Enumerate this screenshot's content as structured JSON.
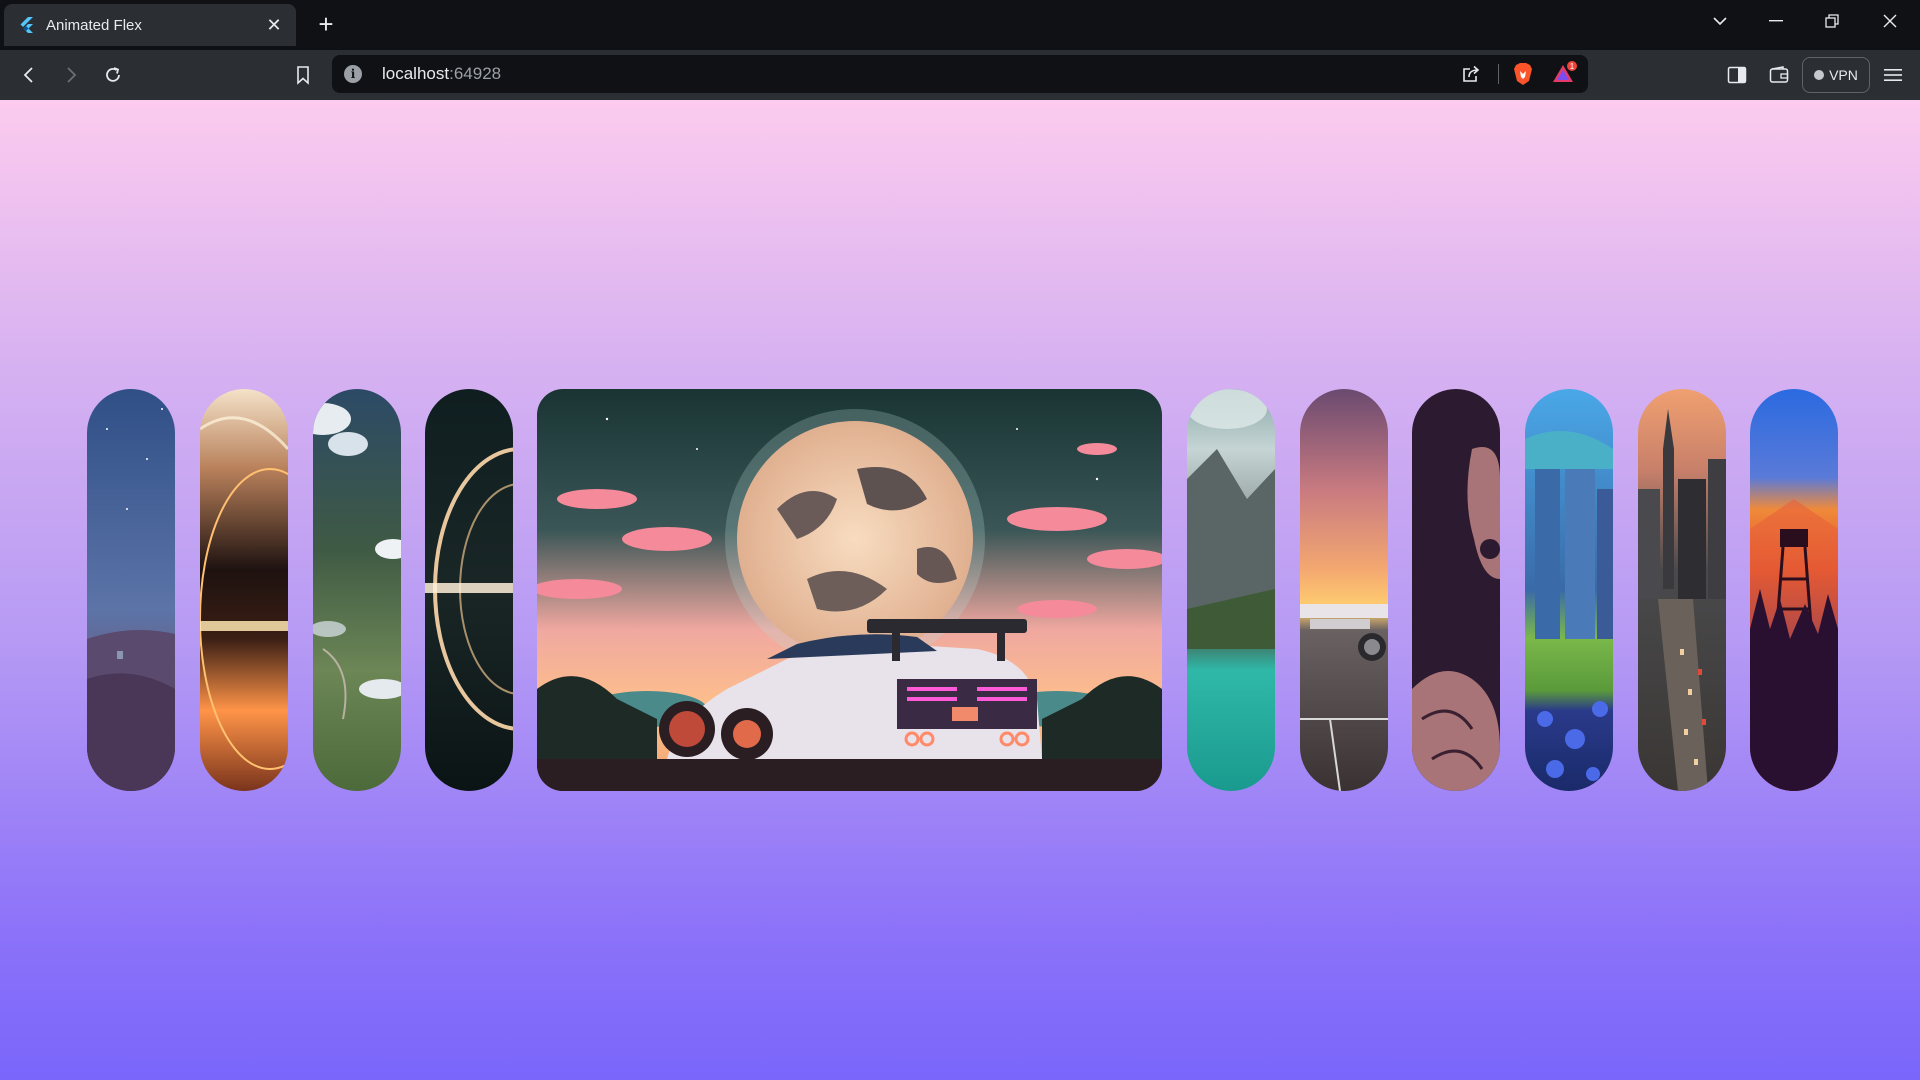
{
  "browser": {
    "tab": {
      "title": "Animated Flex",
      "favicon": "flutter-logo"
    },
    "toolbar": {
      "url_host": "localhost",
      "url_port": ":64928",
      "vpn_label": "VPN",
      "notification_count": "1"
    },
    "icons": [
      "back-arrow-icon",
      "forward-arrow-icon",
      "reload-icon",
      "bookmark-icon",
      "info-icon",
      "share-icon",
      "brave-shield-icon",
      "brave-rewards-icon",
      "sidebar-icon",
      "wallet-icon",
      "menu-icon"
    ]
  },
  "gallery": {
    "selected_index": 4,
    "cards": [
      {
        "name": "night-hills",
        "colors": [
          "#2f4f86",
          "#4f6a9c",
          "#5b4a6e",
          "#3a2a44"
        ]
      },
      {
        "name": "black-hole-orange",
        "colors": [
          "#f4ddc0",
          "#2a1712",
          "#ff9a4a",
          "#8a3a1e"
        ]
      },
      {
        "name": "aerial-clouds",
        "colors": [
          "#2e4f6a",
          "#d9e3ea",
          "#3d5a3a",
          "#6f8a5a"
        ]
      },
      {
        "name": "black-hole-dark",
        "colors": [
          "#0f1e1f",
          "#e8c7a0",
          "#1a2a2a",
          "#0a1414"
        ]
      },
      {
        "name": "moon-supercar",
        "colors": [
          "#1f3a3a",
          "#f0c4a0",
          "#f07a8a",
          "#ffb070"
        ]
      },
      {
        "name": "lake-mountain",
        "colors": [
          "#8aa8ab",
          "#5c6a6a",
          "#2fb8a8",
          "#1e8f86"
        ]
      },
      {
        "name": "airplane-sunset",
        "colors": [
          "#6a4a6e",
          "#f0a070",
          "#5a5a5a",
          "#3a3a3a"
        ]
      },
      {
        "name": "skeleton-purple",
        "colors": [
          "#2a1a30",
          "#b07a80",
          "#3a2030",
          "#2a1a2a"
        ]
      },
      {
        "name": "city-flowers",
        "colors": [
          "#4fa8e0",
          "#3a6aa8",
          "#7ab84a",
          "#2a3a8a"
        ]
      },
      {
        "name": "city-highway",
        "colors": [
          "#e8a070",
          "#4a4a4a",
          "#8a7a6a",
          "#3a3a3a"
        ]
      },
      {
        "name": "fire-tower",
        "colors": [
          "#2a6ae0",
          "#f06a2a",
          "#3a1a3a",
          "#0a0a2a"
        ]
      }
    ]
  }
}
